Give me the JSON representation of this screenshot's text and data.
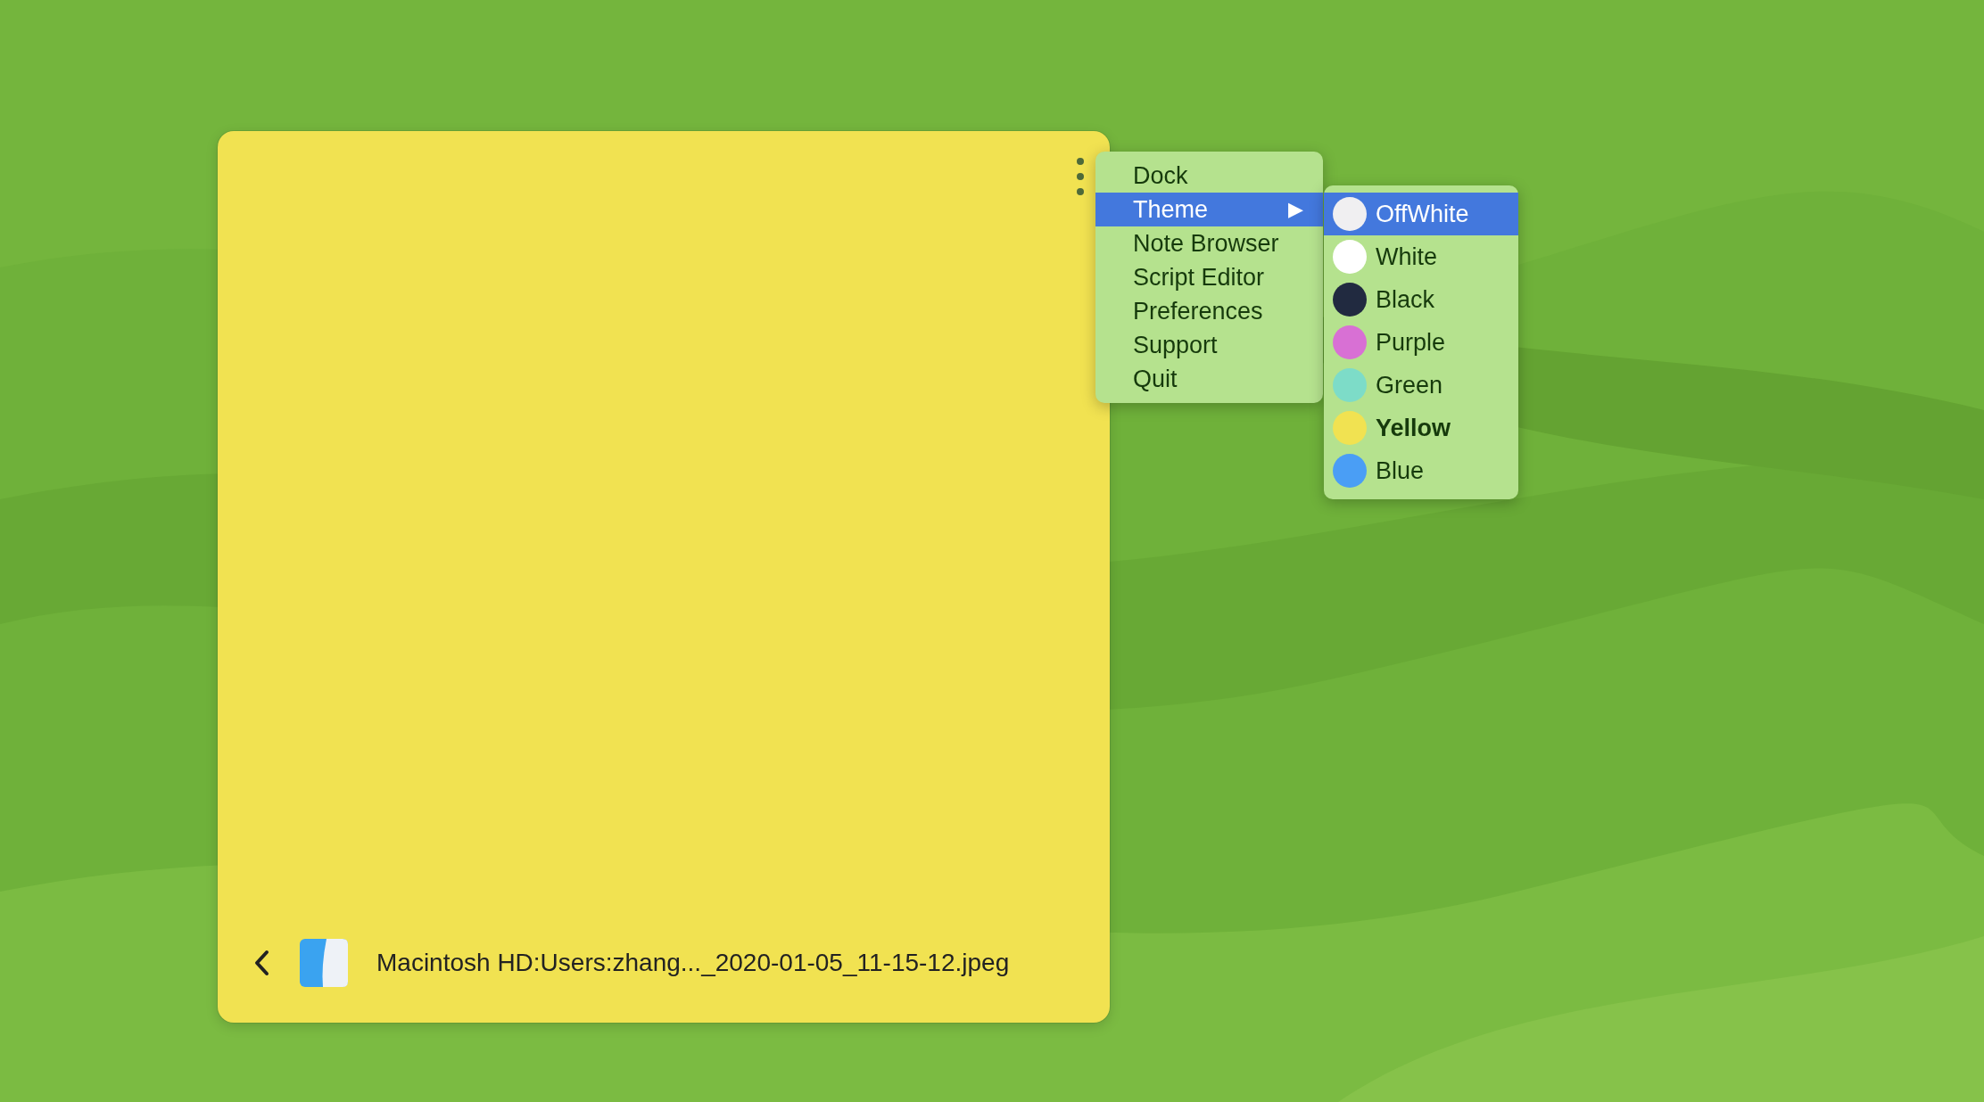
{
  "note": {
    "path": "Macintosh HD:Users:zhang..._2020-01-05_11-15-12.jpeg"
  },
  "menu": {
    "items": [
      {
        "label": "Dock",
        "selected": false
      },
      {
        "label": "Theme",
        "selected": true,
        "arrow": "▶"
      },
      {
        "label": "Note Browser",
        "selected": false
      },
      {
        "label": "Script Editor",
        "selected": false
      },
      {
        "label": "Preferences",
        "selected": false
      },
      {
        "label": "Support",
        "selected": false
      },
      {
        "label": "Quit",
        "selected": false
      }
    ]
  },
  "theme_submenu": {
    "items": [
      {
        "label": "OffWhite",
        "color": "#f0eff1",
        "selected": true,
        "current": false
      },
      {
        "label": "White",
        "color": "#ffffff",
        "selected": false,
        "current": false
      },
      {
        "label": "Black",
        "color": "#212a40",
        "selected": false,
        "current": false
      },
      {
        "label": "Purple",
        "color": "#d870d4",
        "selected": false,
        "current": false
      },
      {
        "label": "Green",
        "color": "#7ddcc8",
        "selected": false,
        "current": false
      },
      {
        "label": "Yellow",
        "color": "#f1e251",
        "selected": false,
        "current": true
      },
      {
        "label": "Blue",
        "color": "#4a9ef5",
        "selected": false,
        "current": false
      }
    ]
  }
}
